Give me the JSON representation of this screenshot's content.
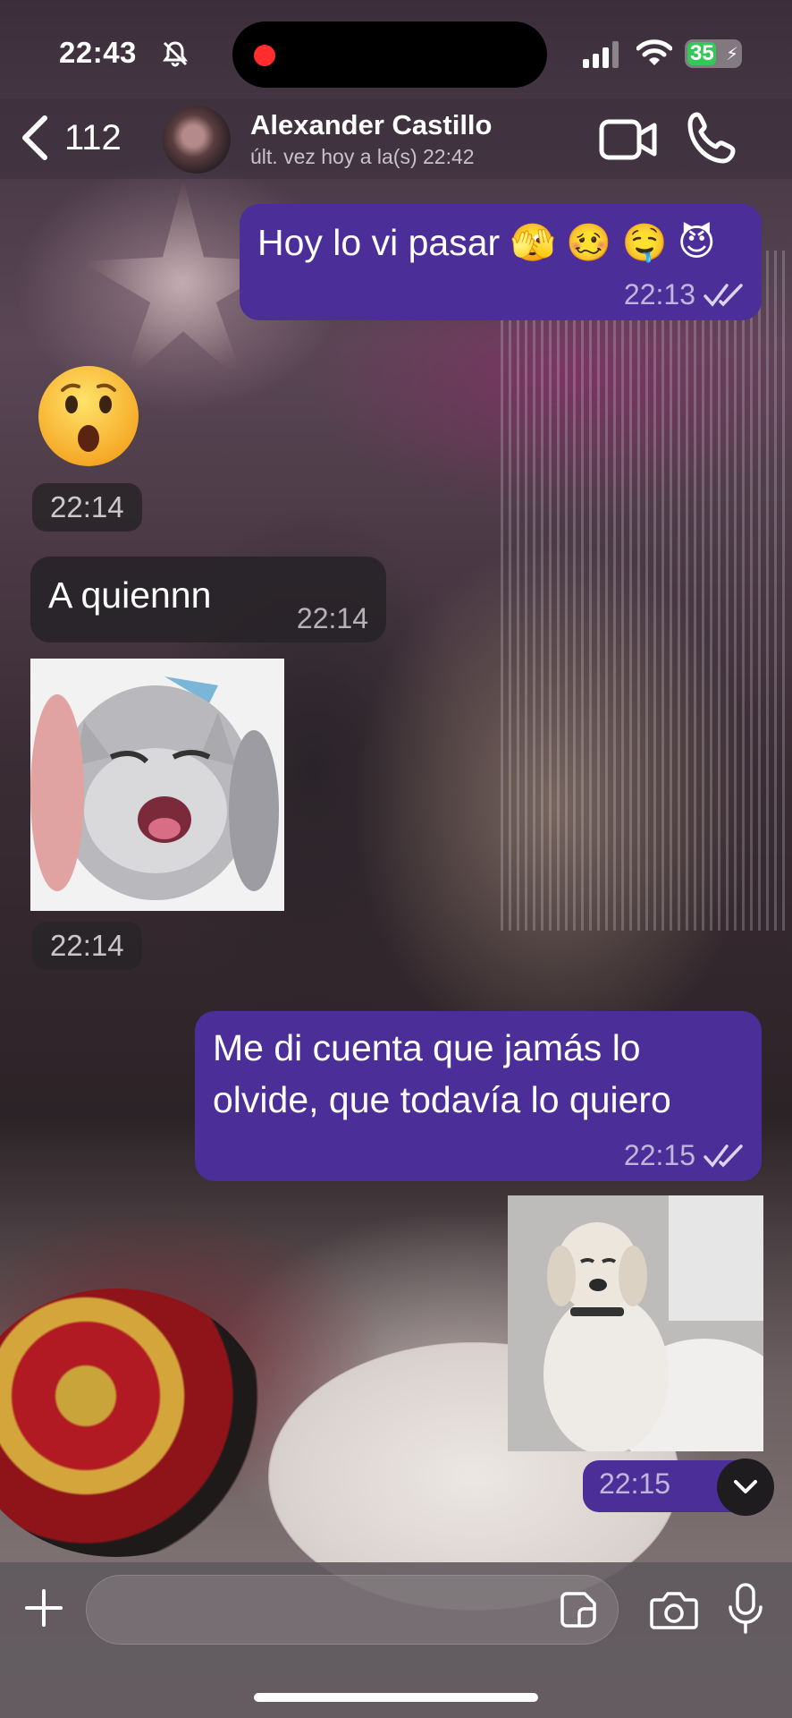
{
  "status_bar": {
    "time": "22:43",
    "battery": "35"
  },
  "header": {
    "back_count": "112",
    "contact_name": "Alexander Castillo",
    "last_seen": "últ. vez hoy a la(s) 22:42"
  },
  "messages": [
    {
      "direction": "outgoing",
      "type": "text",
      "text": "Hoy lo vi pasar 🫣 🥴 🤤 😈",
      "time": "22:13",
      "status": "read"
    },
    {
      "direction": "incoming",
      "type": "emoji",
      "emoji": "😮",
      "time": "22:14"
    },
    {
      "direction": "incoming",
      "type": "text",
      "text": "A quiennn",
      "time": "22:14"
    },
    {
      "direction": "incoming",
      "type": "sticker",
      "sticker": "laughing-cat",
      "time": "22:14"
    },
    {
      "direction": "outgoing",
      "type": "text",
      "text": "Me di cuenta que jamás lo olvide, que todavía lo quiero",
      "time": "22:15",
      "status": "read"
    },
    {
      "direction": "outgoing",
      "type": "sticker",
      "sticker": "smug-dog",
      "time": "22:15",
      "status": "read"
    }
  ],
  "composer": {
    "placeholder": ""
  },
  "colors": {
    "outgoing_bubble": "#4b2e98",
    "incoming_bubble": "#282428",
    "battery_green": "#34c759",
    "recording_dot": "#ff2d2d"
  },
  "icons": [
    "bell-off-icon",
    "signal-icon",
    "wifi-icon",
    "battery-icon",
    "chevron-left-icon",
    "video-camera-icon",
    "phone-icon",
    "double-check-icon",
    "chevron-down-icon",
    "plus-icon",
    "sticker-icon",
    "camera-icon",
    "microphone-icon"
  ]
}
